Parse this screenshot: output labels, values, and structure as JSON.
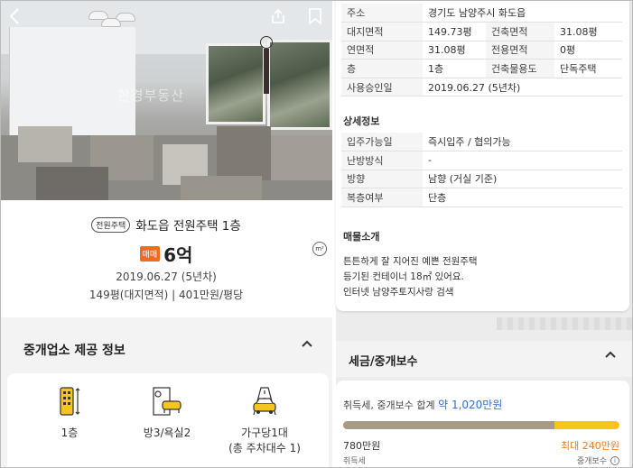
{
  "photo": {
    "watermark": "한경부동산"
  },
  "listing": {
    "type_badge": "전원주택",
    "title": "화도읍 전원주택 1층",
    "deal_type": "매매",
    "price": "6억",
    "approval_date": "2019.06.27 (5년차)",
    "land_area": "149평(대지면적)",
    "separator": "|",
    "price_per_area": "401만원/평당",
    "unit_toggle": "m²"
  },
  "broker_section": {
    "title": "중개업소 제공 정보",
    "features": [
      {
        "label": "1층",
        "icon": "building-floor-icon"
      },
      {
        "label": "방3/욕실2",
        "icon": "rooms-icon"
      },
      {
        "label": "가구당1대",
        "label2": "(총 주차대수 1)",
        "icon": "parking-icon"
      }
    ]
  },
  "detail": {
    "rows": [
      {
        "k": "주소",
        "v": "경기도 남양주시 화도읍"
      },
      {
        "k": "대지면적",
        "v": "149.73평",
        "k2": "건축면적",
        "v2": "31.08평"
      },
      {
        "k": "연면적",
        "v": "31.08평",
        "k2": "전용면적",
        "v2": "0평"
      },
      {
        "k": "층",
        "v": "1층",
        "k2": "건축물용도",
        "v2": "단독주택"
      },
      {
        "k": "사용승인일",
        "v": "2019.06.27 (5년차)"
      }
    ],
    "section_title": "상세정보",
    "extra_rows": [
      {
        "k": "입주가능일",
        "v": "즉시입주 / 협의가능"
      },
      {
        "k": "난방방식",
        "v": "-"
      },
      {
        "k": "방향",
        "v": "남향 (거실 기준)"
      },
      {
        "k": "복층여부",
        "v": "단층"
      }
    ],
    "intro_title": "매물소개",
    "intro_lines": [
      "튼튼하게 잘 지어진 예쁜 전원주택",
      "등기된 컨테이너 18㎡ 있어요.",
      "인터넷 남양주토지사랑 검색"
    ]
  },
  "tax": {
    "title": "세금/중개보수",
    "summary_label": "취득세, 중개보수 합계",
    "summary_prefix": "약",
    "total": "1,020만원",
    "acq_value": "780만원",
    "acq_label": "취득세",
    "max_value": "최대 240만원",
    "fee_label": "중개보수",
    "acq_ratio": 0.765
  },
  "colors": {
    "accent_orange": "#f26b21",
    "link_blue": "#2f6fc7",
    "bar_yellow": "#f7c51e",
    "bar_gray": "#a89b86"
  }
}
